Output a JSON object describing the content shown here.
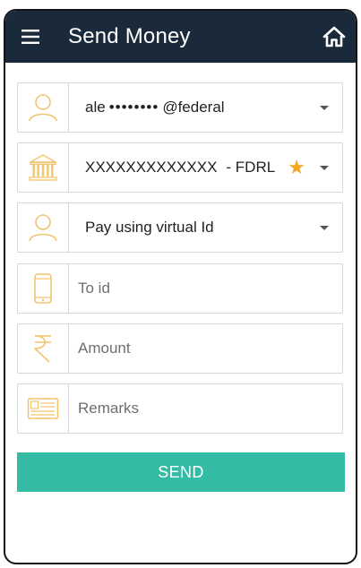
{
  "app_bar": {
    "title": "Send Money",
    "menu_icon": "hamburger-menu-icon",
    "home_icon": "home-icon",
    "background": "#1b2a3b"
  },
  "form": {
    "from_account": {
      "prefix": "ale",
      "masked": "••••••••",
      "suffix": "@federal",
      "icon": "user-icon"
    },
    "bank_account": {
      "number": "XXXXXXXXXXXXX",
      "bank_code": "- FDRL",
      "icon": "bank-icon",
      "favorite_icon": "star-icon"
    },
    "pay_mode": {
      "value": "Pay using virtual Id",
      "icon": "user-icon"
    },
    "to_id": {
      "placeholder": "To id",
      "value": "",
      "icon": "mobile-phone-icon"
    },
    "amount": {
      "placeholder": "Amount",
      "value": "",
      "icon": "rupee-icon"
    },
    "remarks": {
      "placeholder": "Remarks",
      "value": "",
      "icon": "note-card-icon"
    }
  },
  "send_button": {
    "label": "SEND",
    "color": "#33bba4"
  },
  "icon_color": "#f2c46d"
}
